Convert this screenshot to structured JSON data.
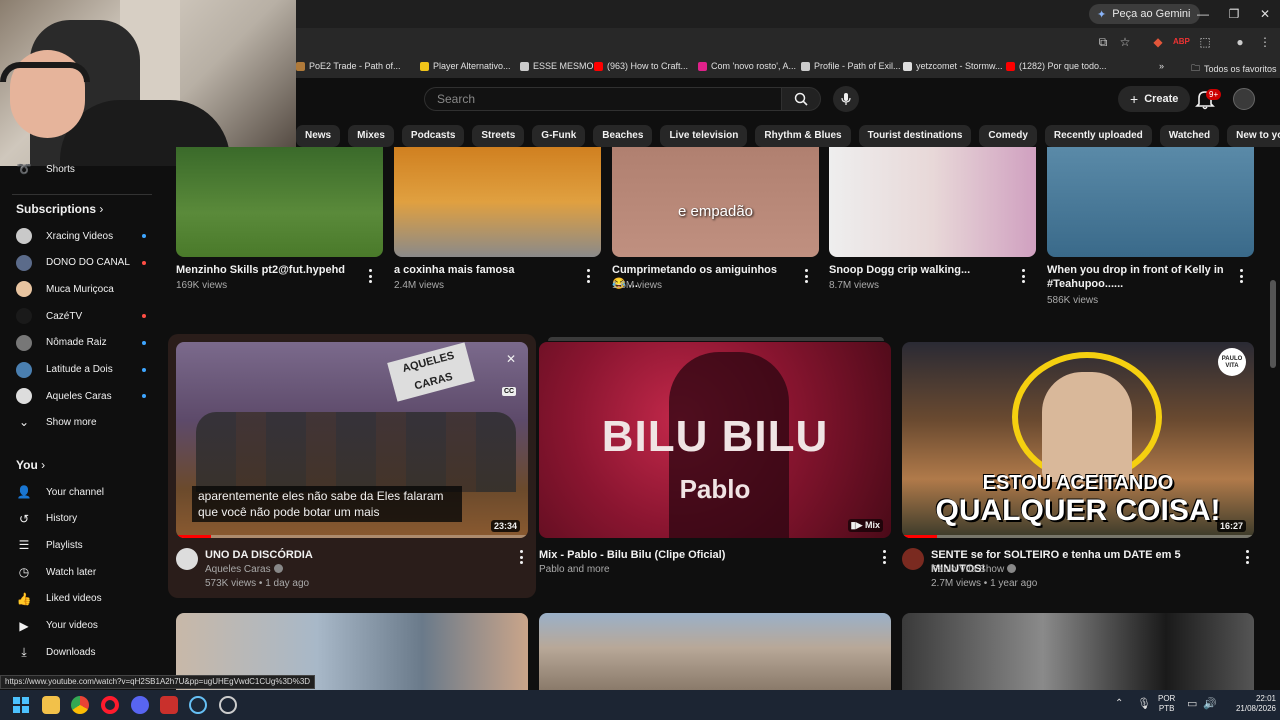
{
  "browser": {
    "gemini_label": "Peça ao Gemini",
    "bookmarks": [
      {
        "label": "PoE2 Trade - Path of...",
        "color": "#b07a3a"
      },
      {
        "label": "Player Alternativo...",
        "color": "#f0c419"
      },
      {
        "label": "ESSE MESMO",
        "color": "#cccccc"
      },
      {
        "label": "(963) How to Craft...",
        "color": "#ff0000"
      },
      {
        "label": "Com 'novo rosto', A...",
        "color": "#e0218a"
      },
      {
        "label": "Profile - Path of Exil...",
        "color": "#cccccc"
      },
      {
        "label": "yetzcomet - Stormw...",
        "color": "#dddddd"
      },
      {
        "label": "(1282) Por que todo...",
        "color": "#ff0000"
      }
    ],
    "all_bookmarks": "Todos os favoritos",
    "status_url": "https://www.youtube.com/watch?v=qH2SB1A2h7U&pp=ugUHEgVwdC1CUg%3D%3D"
  },
  "header": {
    "search_placeholder": "Search",
    "create_label": "Create",
    "notifications_count": "9+"
  },
  "chips": [
    "News",
    "Mixes",
    "Podcasts",
    "Streets",
    "G-Funk",
    "Beaches",
    "Live television",
    "Rhythm & Blues",
    "Tourist destinations",
    "Comedy",
    "Recently uploaded",
    "Watched",
    "New to you"
  ],
  "sidebar": {
    "partial_item": "Shorts",
    "subscriptions_title": "Subscriptions",
    "subscriptions": [
      {
        "label": "Xracing Videos",
        "live": "dot",
        "color": "#c9c9c9"
      },
      {
        "label": "DONO DO CANAL",
        "live": "live",
        "color": "#5b6b8a"
      },
      {
        "label": "Muca Muriçoca",
        "live": "",
        "color": "#e8c4a0"
      },
      {
        "label": "CazéTV",
        "live": "live",
        "color": "#1a1a1a"
      },
      {
        "label": "Nômade Raiz",
        "live": "dot",
        "color": "#777777"
      },
      {
        "label": "Latitude a Dois",
        "live": "dot",
        "color": "#4a7fb0"
      },
      {
        "label": "Aqueles Caras",
        "live": "dot",
        "color": "#dddddd"
      }
    ],
    "show_more": "Show more",
    "you_title": "You",
    "you_items": [
      {
        "label": "Your channel",
        "icon": "channel-icon"
      },
      {
        "label": "History",
        "icon": "history-icon"
      },
      {
        "label": "Playlists",
        "icon": "playlists-icon"
      },
      {
        "label": "Watch later",
        "icon": "watch-later-icon"
      },
      {
        "label": "Liked videos",
        "icon": "like-icon"
      },
      {
        "label": "Your videos",
        "icon": "your-videos-icon"
      },
      {
        "label": "Downloads",
        "icon": "downloads-icon"
      }
    ]
  },
  "shorts": [
    {
      "title": "Menzinho Skills pt2@fut.hypehd",
      "views": "169K views"
    },
    {
      "title": "a coxinha mais famosa",
      "views": "2.4M views"
    },
    {
      "title": "Cumprimetando os amiguinhos 😂 ...",
      "views": "1.6M views",
      "caption": "e empadão"
    },
    {
      "title": "Snoop Dogg crip walking...",
      "views": "8.7M views"
    },
    {
      "title": "When you drop in front of Kelly in #Teahupoo......",
      "views": "586K views"
    }
  ],
  "videos": [
    {
      "title": "UNO DA DISCÓRDIA",
      "channel": "Aqueles Caras",
      "meta": "573K views • 1 day ago",
      "duration": "23:34",
      "caption": "aparentemente eles não sabe da Eles falaram que você não pode botar um mais",
      "cc": "CC"
    },
    {
      "title": "Mix - Pablo - Bilu Bilu (Clipe Oficial)",
      "channel": "Pablo and more",
      "meta": "",
      "duration": "Mix",
      "overlay_title": "BILU BILU",
      "overlay_sub": "Pablo"
    },
    {
      "title": "SENTE se for SOLTEIRO e tenha um DATE em 5 MINUTOS!",
      "channel": "Paulo Vita Show",
      "meta": "2.7M views • 1 year ago",
      "duration": "16:27",
      "overlay_line1": "ESTOU ACEITANDO",
      "overlay_line2": "QUALQUER COISA!",
      "logo_text": "PAULO VITA"
    }
  ],
  "taskbar": {
    "lang_top": "POR",
    "lang_bottom": "PTB",
    "time": "22:01",
    "date": "21/08/2026"
  }
}
